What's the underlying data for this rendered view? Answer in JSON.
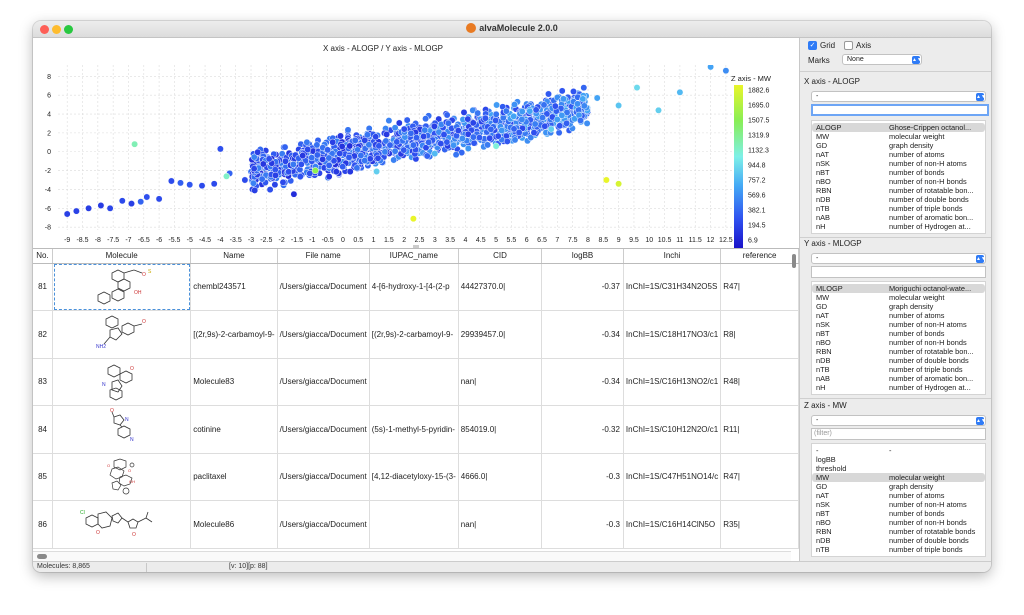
{
  "window": {
    "title": "alvaMolecule 2.0.0",
    "traffic_lights": [
      {
        "name": "close",
        "color": "#fe5f57"
      },
      {
        "name": "minimize",
        "color": "#febc2e"
      },
      {
        "name": "zoom",
        "color": "#28c840"
      }
    ]
  },
  "chart": {
    "title": "X axis - ALOGP / Y axis - MLOGP",
    "colorbar_title": "Z axis - MW",
    "colorbar_ticks": [
      "1882.6",
      "1695.0",
      "1507.5",
      "1319.9",
      "1132.3",
      "944.8",
      "757.2",
      "569.6",
      "382.1",
      "194.5",
      "6.9"
    ],
    "x_ticks": [
      "-9",
      "-8.5",
      "-8",
      "-7.5",
      "-7",
      "-6.5",
      "-6",
      "-5.5",
      "-5",
      "-4.5",
      "-4",
      "-3.5",
      "-3",
      "-2.5",
      "-2",
      "-1.5",
      "-1",
      "-0.5",
      "0",
      "0.5",
      "1",
      "1.5",
      "2",
      "2.5",
      "3",
      "3.5",
      "4",
      "4.5",
      "5",
      "5.5",
      "6",
      "6.5",
      "7",
      "7.5",
      "8",
      "8.5",
      "9",
      "9.5",
      "10",
      "10.5",
      "11",
      "11.5",
      "12",
      "12.5"
    ],
    "y_ticks": [
      "8",
      "6",
      "4",
      "2",
      "0",
      "-2",
      "-4",
      "-6",
      "-8"
    ]
  },
  "chart_data": {
    "type": "scatter",
    "title": "X axis - ALOGP / Y axis - MLOGP",
    "xlabel": "ALOGP",
    "ylabel": "MLOGP",
    "zlabel": "MW",
    "xlim": [
      -9.3,
      12.7
    ],
    "ylim": [
      -8.3,
      9.2
    ],
    "zlim": [
      6.9,
      1882.6
    ],
    "grid": true,
    "colorbar": "right",
    "n_points": 8865,
    "points": [
      [
        -9.0,
        -6.6,
        250
      ],
      [
        -8.7,
        -6.3,
        260
      ],
      [
        -8.3,
        -6.0,
        240
      ],
      [
        -7.9,
        -5.7,
        230
      ],
      [
        -7.6,
        -6.0,
        280
      ],
      [
        -7.2,
        -5.2,
        300
      ],
      [
        -6.9,
        -5.5,
        250
      ],
      [
        -6.6,
        -5.3,
        420
      ],
      [
        -6.4,
        -4.8,
        330
      ],
      [
        -6.0,
        -5.0,
        300
      ],
      [
        -5.6,
        -3.1,
        310
      ],
      [
        -5.3,
        -3.3,
        400
      ],
      [
        -5.0,
        -3.5,
        360
      ],
      [
        -4.6,
        -3.6,
        300
      ],
      [
        -4.2,
        -3.4,
        310
      ],
      [
        -4.0,
        0.3,
        330
      ],
      [
        -3.7,
        -2.3,
        420
      ],
      [
        -3.2,
        -3.0,
        300
      ],
      [
        -2.9,
        -1.8,
        280
      ],
      [
        -2.6,
        -1.3,
        200
      ],
      [
        -2.2,
        -2.5,
        250
      ],
      [
        -1.6,
        -4.5,
        150
      ],
      [
        -0.9,
        -2.0,
        1500
      ],
      [
        -0.5,
        0.2,
        400
      ],
      [
        0.2,
        -0.6,
        380
      ],
      [
        0.4,
        1.2,
        450
      ],
      [
        0.8,
        1.8,
        500
      ],
      [
        1.1,
        -2.1,
        900
      ],
      [
        1.5,
        3.3,
        560
      ],
      [
        2.0,
        2.4,
        320
      ],
      [
        2.3,
        0.7,
        450
      ],
      [
        2.7,
        3.5,
        480
      ],
      [
        3.0,
        -0.2,
        800
      ],
      [
        3.4,
        3.9,
        420
      ],
      [
        3.9,
        1.4,
        600
      ],
      [
        4.4,
        4.1,
        500
      ],
      [
        5.0,
        0.6,
        1100
      ],
      [
        5.6,
        5.0,
        620
      ],
      [
        6.1,
        4.3,
        700
      ],
      [
        6.8,
        2.4,
        900
      ],
      [
        7.2,
        5.6,
        650
      ],
      [
        8.3,
        5.7,
        700
      ],
      [
        9.0,
        4.9,
        850
      ],
      [
        9.6,
        6.8,
        950
      ],
      [
        10.3,
        4.4,
        900
      ],
      [
        11.0,
        6.3,
        800
      ],
      [
        12.0,
        9.0,
        700
      ],
      [
        12.5,
        8.6,
        600
      ],
      [
        8.6,
        -3.0,
        1900
      ],
      [
        9.0,
        -3.4,
        1800
      ],
      [
        2.3,
        -7.1,
        1900
      ],
      [
        -6.8,
        0.8,
        1200
      ],
      [
        -3.8,
        -2.6,
        1150
      ]
    ]
  },
  "table": {
    "columns": [
      "No.",
      "Molecule",
      "Name",
      "File name",
      "IUPAC_name",
      "CID",
      "logBB",
      "Inchi",
      "reference"
    ],
    "rows": [
      {
        "no": "81",
        "name": "chembl243571",
        "file": "/Users/giacca/Document",
        "iupac": "4-[6-hydroxy-1-[4-(2-p",
        "cid": "44427370.0|",
        "logbb": "-0.37",
        "inchi": "InChI=1S/C31H34N2O5S",
        "ref": "R47|"
      },
      {
        "no": "82",
        "name": "[(2r,9s)-2-carbamoyl-9-",
        "file": "/Users/giacca/Document",
        "iupac": "[(2r,9s)-2-carbamoyl-9-",
        "cid": "29939457.0|",
        "logbb": "-0.34",
        "inchi": "InChI=1S/C18H17NO3/c1",
        "ref": "R8|"
      },
      {
        "no": "83",
        "name": "Molecule83",
        "file": "/Users/giacca/Document",
        "iupac": "",
        "cid": "nan|",
        "logbb": "-0.34",
        "inchi": "InChI=1S/C16H13NO2/c1",
        "ref": "R48|"
      },
      {
        "no": "84",
        "name": "cotinine",
        "file": "/Users/giacca/Document",
        "iupac": "(5s)-1-methyl-5-pyridin-",
        "cid": "854019.0|",
        "logbb": "-0.32",
        "inchi": "InChI=1S/C10H12N2O/c1",
        "ref": "R11|"
      },
      {
        "no": "85",
        "name": "paclitaxel",
        "file": "/Users/giacca/Document",
        "iupac": "[4,12-diacetyloxy-15-(3-",
        "cid": "4666.0|",
        "logbb": "-0.3",
        "inchi": "InChI=1S/C47H51NO14/c",
        "ref": "R47|"
      },
      {
        "no": "86",
        "name": "Molecule86",
        "file": "/Users/giacca/Document",
        "iupac": "",
        "cid": "nan|",
        "logbb": "-0.3",
        "inchi": "InChI=1S/C16H14ClN5O",
        "ref": "R35|"
      }
    ]
  },
  "status": {
    "molecules": "Molecules: 8,865",
    "position": "[v: 10][p: 88]"
  },
  "panel": {
    "grid_label": "Grid",
    "grid_checked": true,
    "axis_label": "Axis",
    "axis_checked": false,
    "marks_label": "Marks",
    "marks_value": "None",
    "x_section": {
      "title": "X axis - ALOGP",
      "select": "-",
      "filter": "",
      "items": [
        [
          "ALOGP",
          "Ghose-Crippen octanol..."
        ],
        [
          "MW",
          "molecular weight"
        ],
        [
          "GD",
          "graph density"
        ],
        [
          "nAT",
          "number of atoms"
        ],
        [
          "nSK",
          "number of non-H atoms"
        ],
        [
          "nBT",
          "number of bonds"
        ],
        [
          "nBO",
          "number of non-H bonds"
        ],
        [
          "RBN",
          "number of rotatable bon..."
        ],
        [
          "nDB",
          "number of double bonds"
        ],
        [
          "nTB",
          "number of triple bonds"
        ],
        [
          "nAB",
          "number of aromatic bon..."
        ],
        [
          "nH",
          "number of Hydrogen at..."
        ]
      ]
    },
    "y_section": {
      "title": "Y axis - MLOGP",
      "select": "-",
      "filter": "",
      "items": [
        [
          "MLOGP",
          "Moriguchi octanol-wate..."
        ],
        [
          "MW",
          "molecular weight"
        ],
        [
          "GD",
          "graph density"
        ],
        [
          "nAT",
          "number of atoms"
        ],
        [
          "nSK",
          "number of non-H atoms"
        ],
        [
          "nBT",
          "number of bonds"
        ],
        [
          "nBO",
          "number of non-H bonds"
        ],
        [
          "RBN",
          "number of rotatable bon..."
        ],
        [
          "nDB",
          "number of double bonds"
        ],
        [
          "nTB",
          "number of triple bonds"
        ],
        [
          "nAB",
          "number of aromatic bon..."
        ],
        [
          "nH",
          "number of Hydrogen at..."
        ]
      ]
    },
    "z_section": {
      "title": "Z axis - MW",
      "select": "-",
      "filter_placeholder": "(filter)",
      "items": [
        [
          "-",
          "-"
        ],
        [
          "logBB",
          ""
        ],
        [
          "threshold",
          ""
        ],
        [
          "MW",
          "molecular weight"
        ],
        [
          "GD",
          "graph density"
        ],
        [
          "nAT",
          "number of atoms"
        ],
        [
          "nSK",
          "number of non-H atoms"
        ],
        [
          "nBT",
          "number of bonds"
        ],
        [
          "nBO",
          "number of non-H bonds"
        ],
        [
          "RBN",
          "number of rotatable bonds"
        ],
        [
          "nDB",
          "number of double bonds"
        ],
        [
          "nTB",
          "number of triple bonds"
        ]
      ]
    }
  }
}
